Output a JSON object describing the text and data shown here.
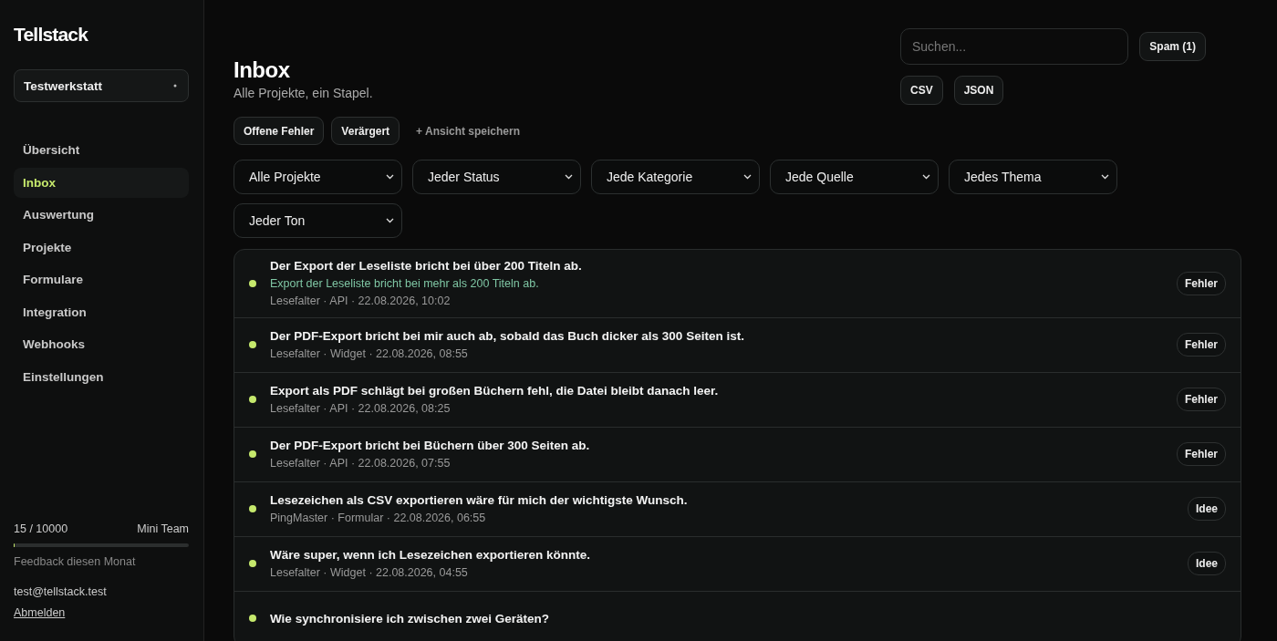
{
  "brand": "Tellstack",
  "workspace": {
    "name": "Testwerkstatt"
  },
  "nav": [
    {
      "label": "Übersicht",
      "selected": false
    },
    {
      "label": "Inbox",
      "selected": true
    },
    {
      "label": "Auswertung",
      "selected": false
    },
    {
      "label": "Projekte",
      "selected": false
    },
    {
      "label": "Formulare",
      "selected": false
    },
    {
      "label": "Integration",
      "selected": false
    },
    {
      "label": "Webhooks",
      "selected": false
    },
    {
      "label": "Einstellungen",
      "selected": false
    }
  ],
  "usage": {
    "count": "15 / 10000",
    "plan": "Mini Team",
    "level": 0.0015,
    "caption": "Feedback diesen Monat"
  },
  "account": {
    "email": "test@tellstack.test",
    "logout": "Abmelden"
  },
  "header": {
    "title": "Inbox",
    "subtitle": "Alle Projekte, ein Stapel.",
    "search": {
      "placeholder": "Suchen..."
    },
    "spam": "Spam (1)",
    "exports": [
      "CSV",
      "JSON"
    ]
  },
  "saved_views": [
    "Offene Fehler",
    "Verärgert"
  ],
  "save_view": "+ Ansicht speichern",
  "filters": [
    "Alle Projekte",
    "Jeder Status",
    "Jede Kategorie",
    "Jede Quelle",
    "Jedes Thema",
    "Jeder Ton"
  ],
  "items": [
    {
      "title": "Der Export der Leseliste bricht bei über 200 Titeln ab.",
      "summary": "Export der Leseliste bricht bei mehr als 200 Titeln ab.",
      "meta": "Lesefalter · API · 22.08.2026, 10:02",
      "tag": "Fehler"
    },
    {
      "title": "Der PDF-Export bricht bei mir auch ab, sobald das Buch dicker als 300 Seiten ist.",
      "meta": "Lesefalter · Widget · 22.08.2026, 08:55",
      "tag": "Fehler"
    },
    {
      "title": "Export als PDF schlägt bei großen Büchern fehl, die Datei bleibt danach leer.",
      "meta": "Lesefalter · API · 22.08.2026, 08:25",
      "tag": "Fehler"
    },
    {
      "title": "Der PDF-Export bricht bei Büchern über 300 Seiten ab.",
      "meta": "Lesefalter · API · 22.08.2026, 07:55",
      "tag": "Fehler"
    },
    {
      "title": "Lesezeichen als CSV exportieren wäre für mich der wichtigste Wunsch.",
      "meta": "PingMaster · Formular · 22.08.2026, 06:55",
      "tag": "Idee"
    },
    {
      "title": "Wäre super, wenn ich Lesezeichen exportieren könnte.",
      "meta": "Lesefalter · Widget · 22.08.2026, 04:55",
      "tag": "Idee"
    },
    {
      "title": "Wie synchronisiere ich zwischen zwei Geräten?"
    }
  ]
}
